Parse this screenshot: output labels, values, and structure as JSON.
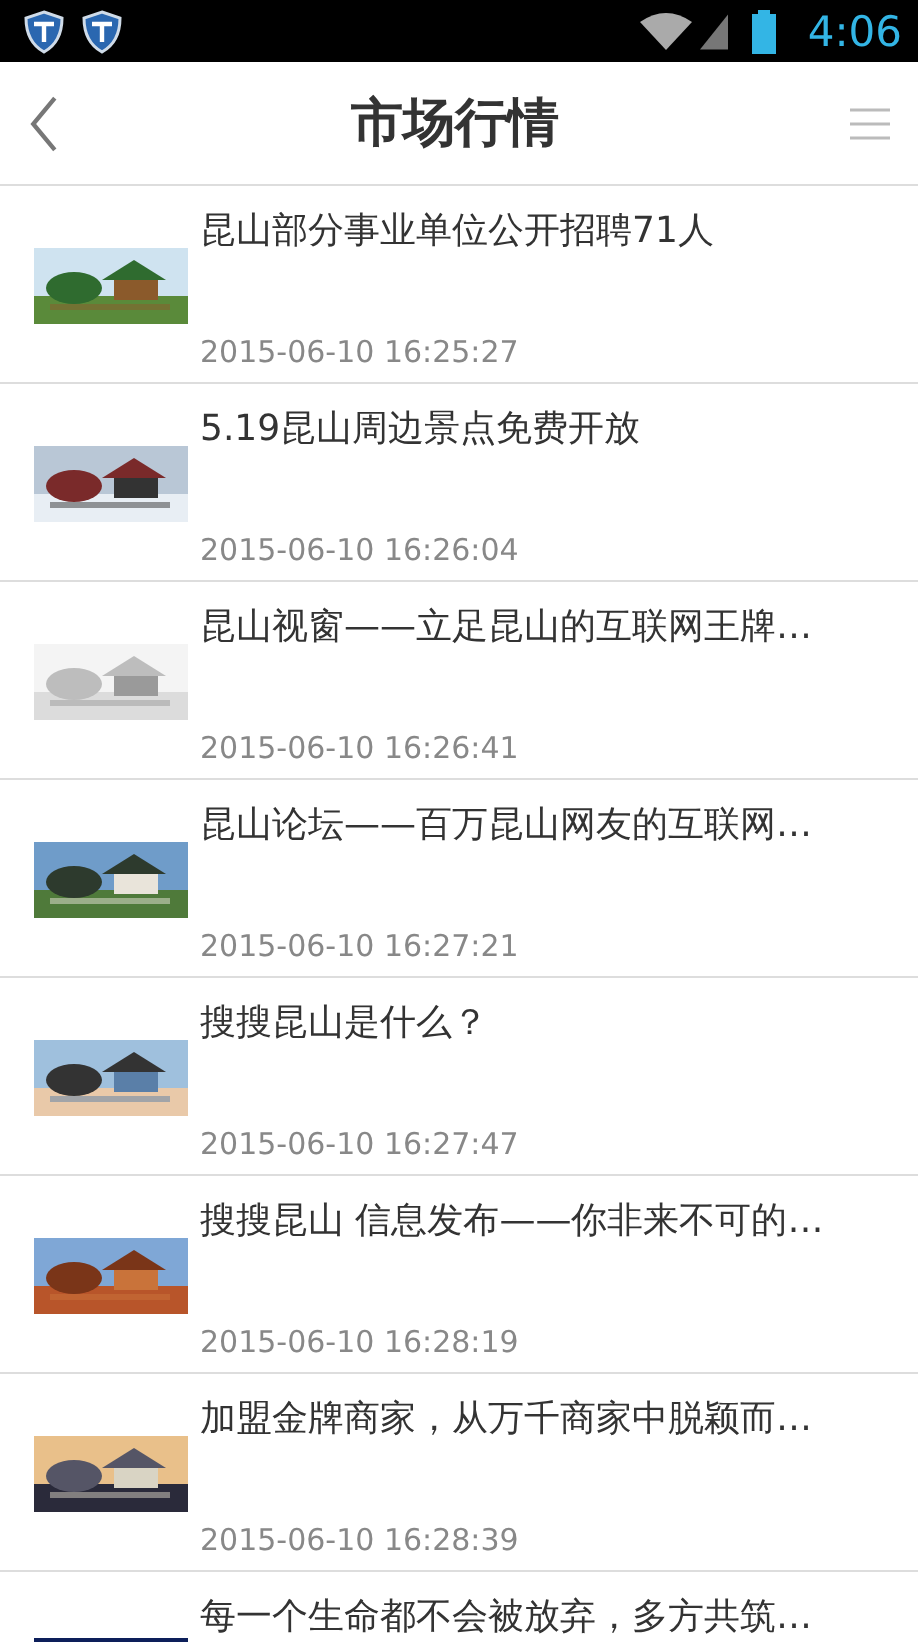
{
  "status_bar": {
    "time": "4:06"
  },
  "header": {
    "title": "市场行情"
  },
  "articles": [
    {
      "title": "昆山部分事业单位公开招聘71人",
      "date": "2015-06-10 16:25:27"
    },
    {
      "title": "5.19昆山周边景点免费开放",
      "date": "2015-06-10 16:26:04"
    },
    {
      "title": "昆山视窗——立足昆山的互联网王牌…",
      "date": "2015-06-10 16:26:41"
    },
    {
      "title": "昆山论坛——百万昆山网友的互联网…",
      "date": "2015-06-10 16:27:21"
    },
    {
      "title": "搜搜昆山是什么？",
      "date": "2015-06-10 16:27:47"
    },
    {
      "title": "搜搜昆山 信息发布——你非来不可的…",
      "date": "2015-06-10 16:28:19"
    },
    {
      "title": "加盟金牌商家，从万千商家中脱颖而…",
      "date": "2015-06-10 16:28:39"
    },
    {
      "title": "每一个生命都不会被放弃，多方共筑…"
    }
  ]
}
